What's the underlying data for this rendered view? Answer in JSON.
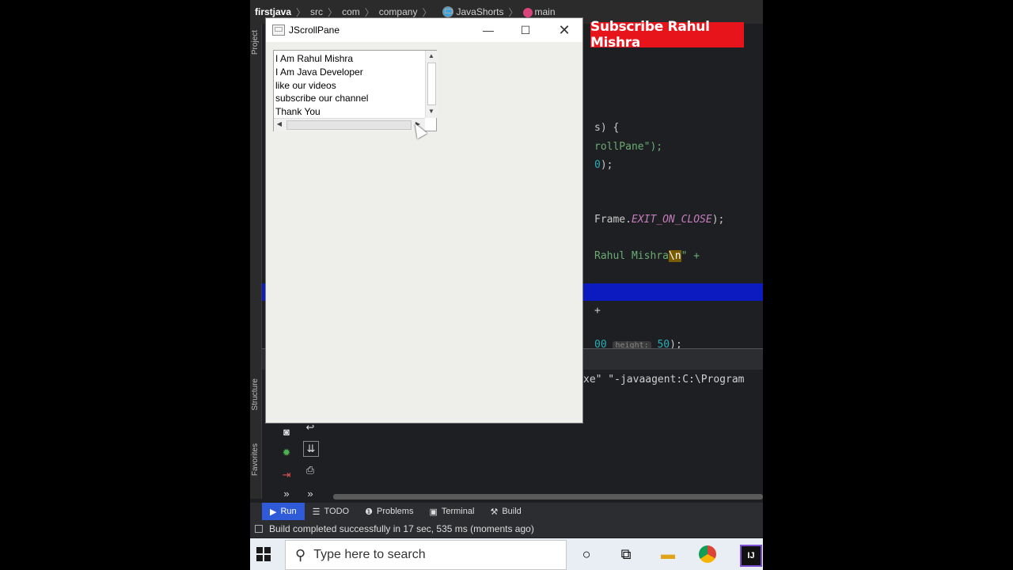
{
  "ide": {
    "breadcrumbs": [
      "firstjava",
      "src",
      "com",
      "company",
      "JavaShorts",
      "main"
    ],
    "left_labels": [
      "Project",
      "Structure",
      "Favorites"
    ],
    "code_lines": [
      {
        "pre": "s) {",
        "parts": []
      },
      {
        "pre": "",
        "str": "rollPane\");"
      },
      {
        "pre": "",
        "num": "0",
        "post": ");"
      },
      {
        "pre": "Frame.",
        "kw": "EXIT_ON_CLOSE",
        "post": ");"
      },
      {
        "str": "Rahul Mishra",
        "hl": "\\n",
        "str2": "\" +"
      },
      {
        "pre": "+"
      },
      {
        "num": "50",
        "hint": "height:",
        "num2": "50",
        "post": ");"
      }
    ],
    "code": {
      "l1": "s) {",
      "l2": "rollPane\");",
      "l3_num": "0",
      "l3_post": ");",
      "l4_pre": "Frame.",
      "l4_kw": "EXIT_ON_CLOSE",
      "l4_post": ");",
      "l5_str": "Rahul Mishra",
      "l5_hl": "\\n",
      "l5_post": "\" +",
      "l7": "+",
      "l8_num": "00",
      "l8_hint": "height:",
      "l8_num2": "50",
      "l8_post": ");"
    },
    "console_line": "xe\" \"-javaagent:C:\\Program",
    "banner": "Subscribe Rahul Mishra",
    "tabs": [
      {
        "label": "Run",
        "icon": "play-icon",
        "active": true
      },
      {
        "label": "TODO",
        "icon": "list-icon"
      },
      {
        "label": "Problems",
        "icon": "info-icon"
      },
      {
        "label": "Terminal",
        "icon": "terminal-icon"
      },
      {
        "label": "Build",
        "icon": "hammer-icon"
      }
    ],
    "status": "Build completed successfully in 17 sec, 535 ms (moments ago)"
  },
  "window": {
    "title": "JScrollPane",
    "text_lines": [
      "I Am Rahul Mishra",
      "I Am Java Developer",
      "like our videos",
      "subscribe our channel",
      "Thank You"
    ]
  },
  "taskbar": {
    "search_placeholder": "Type here to search"
  },
  "colors": {
    "banner": "#e8141b",
    "run_tab": "#2f5bd8",
    "selection": "#0b1bbf"
  }
}
